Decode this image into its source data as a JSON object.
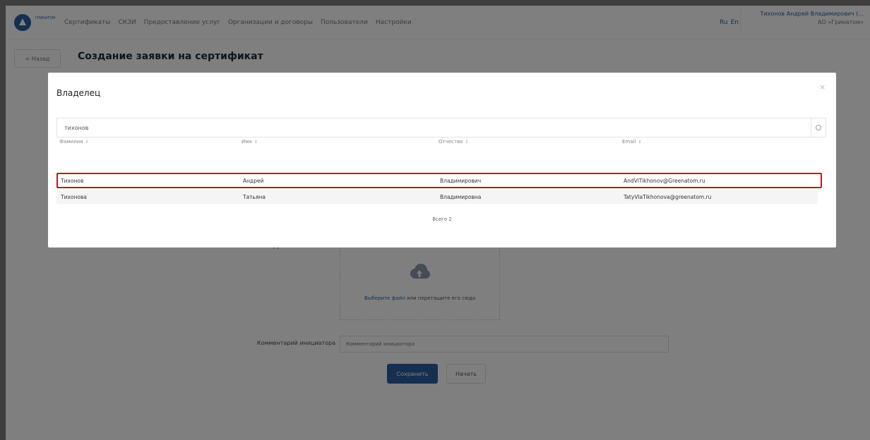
{
  "header": {
    "logo_text": "ГРИНАТОМ",
    "nav": [
      "Сертификаты",
      "СКЗИ",
      "Предоставление услуг",
      "Организации и договоры",
      "Пользователи",
      "Настройки"
    ],
    "lang": [
      "Ru",
      "En"
    ],
    "user_name": "Тихонов Андрей Владимирович (...",
    "user_org": "АО «Гринатом»"
  },
  "page": {
    "back_label": "< Назад",
    "title": "Создание заявки на сертификат",
    "upload_label": "Загруженные вложения",
    "upload_link": "Выберите файл",
    "upload_text": " или перетащите его сюда",
    "comment_label": "Комментарий инициатора",
    "comment_placeholder": "Комментарий инициатора",
    "save_label": "Сохранить",
    "reset_label": "Начать"
  },
  "modal": {
    "title": "Владелец",
    "close": "×",
    "search_value": "тихонов",
    "columns": [
      "Фамилия",
      "Имя",
      "Отчество",
      "Email"
    ],
    "sort_glyph": "⇕",
    "rows": [
      {
        "last": "Тихонов",
        "first": "Андрей",
        "middle": "Владимирович",
        "email": "AndVlTikhonov@Greenatom.ru"
      },
      {
        "last": "Тихонова",
        "first": "Татьяна",
        "middle": "Владимировна",
        "email": "TatyVlaTikhonova@greenatom.ru"
      }
    ],
    "total": "Всего 2"
  },
  "colors": {
    "accent": "#2b5fa3",
    "highlight": "#c0161c"
  }
}
